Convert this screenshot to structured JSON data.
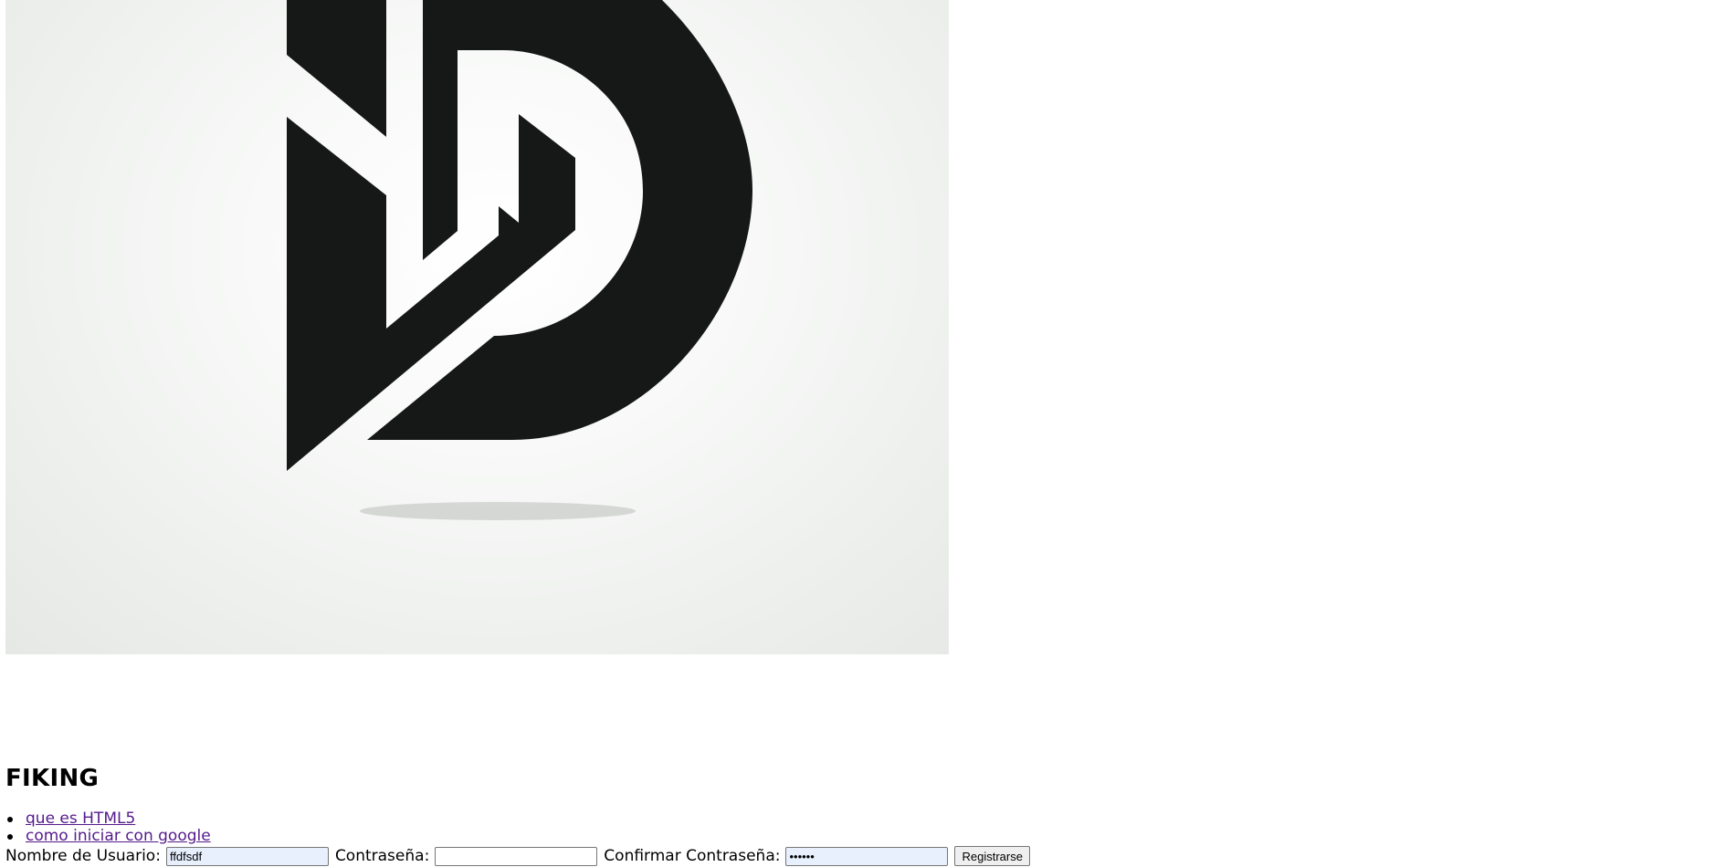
{
  "logo": {
    "icon": "stylized-d-logo",
    "colors": {
      "mark": "#161717",
      "background": "#eef0ee",
      "shadow": "#d2d4d2"
    }
  },
  "header": {
    "title": "FIKING"
  },
  "nav": {
    "items": [
      {
        "label": "que es HTML5"
      },
      {
        "label": "como iniciar con google"
      }
    ],
    "link_color": "#551a8b"
  },
  "form": {
    "username": {
      "label": "Nombre de Usuario:",
      "value": "ffdfsdf"
    },
    "password": {
      "label": "Contraseña:",
      "value": ""
    },
    "confirm_password": {
      "label": "Confirmar Contraseña:",
      "value": "••••••"
    },
    "submit_label": "Registrarse"
  }
}
